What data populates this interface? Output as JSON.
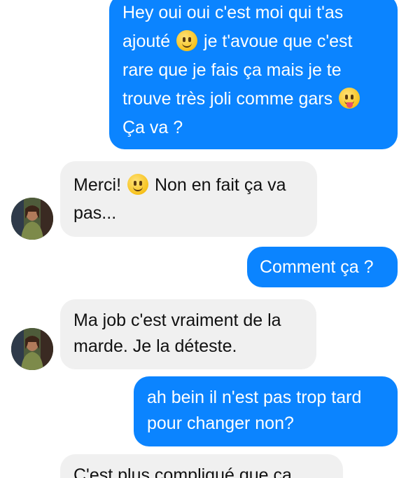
{
  "conversation": {
    "messages": [
      {
        "side": "out",
        "text_parts": [
          "Hey oui oui c'est moi qui t'as ajouté",
          "je t'avoue que c'est rare que je fais ça mais je te trouve très joli comme gars",
          "Ça va ?"
        ],
        "emojis": [
          "smiling-face",
          "tongue-out-face"
        ]
      },
      {
        "side": "in",
        "text_parts": [
          "Merci!",
          "Non en fait ça va pas..."
        ],
        "emojis": [
          "smiling-face"
        ]
      },
      {
        "side": "out",
        "text": "Comment ça ?"
      },
      {
        "side": "in",
        "text": "Ma job c'est vraiment de la marde. Je la déteste."
      },
      {
        "side": "out",
        "text": "ah bein il n'est pas trop tard pour changer non?"
      },
      {
        "side": "in",
        "text": "C'est plus compliqué que ça..."
      }
    ]
  },
  "colors": {
    "outgoing_bubble": "#0b84ff",
    "incoming_bubble": "#f0f0f0",
    "outgoing_text": "#ffffff",
    "incoming_text": "#111111"
  },
  "icons": {
    "avatar": "contact-avatar-photo",
    "emoji_smile": "smiling-face-emoji",
    "emoji_tongue": "tongue-out-emoji"
  }
}
